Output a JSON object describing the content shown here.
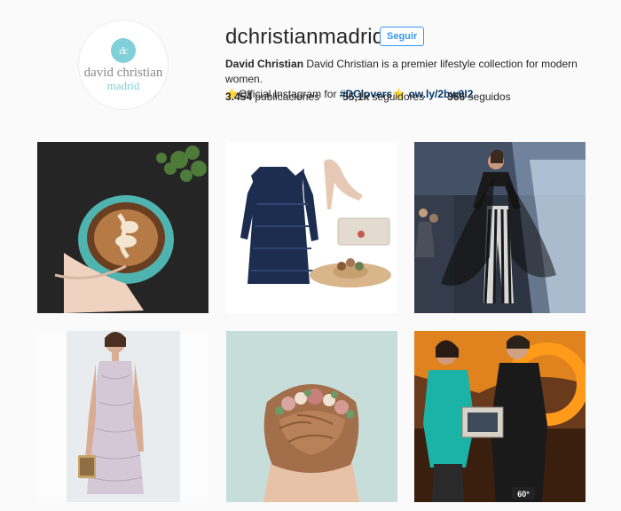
{
  "profile": {
    "avatar": {
      "monogram": "dc",
      "brand_line1": "david christian",
      "brand_line2": "madrid"
    },
    "username": "dchristianmadrid",
    "follow_label": "Seguir",
    "bio": {
      "name": "David Christian",
      "text": "David Christian is a premier lifestyle collection for modern women.",
      "star": "⭐",
      "line2_pre": "Official Instagram for ",
      "hashtag": "#DClovers",
      "link": "ow.ly/2bw0I2"
    },
    "stats": [
      {
        "count": "3.454",
        "label": " publicaciones"
      },
      {
        "count": "55,1k",
        "label": " seguidores"
      },
      {
        "count": "366",
        "label": " seguidos"
      }
    ]
  },
  "posts": [
    {
      "icon": "coffee-latte-art-photo"
    },
    {
      "icon": "navy-dress-flat-lay-photo"
    },
    {
      "icon": "runway-model-photo"
    },
    {
      "icon": "lace-dress-model-photo"
    },
    {
      "icon": "floral-hair-accessory-photo"
    },
    {
      "icon": "tv-show-presenters-photo",
      "badge": "60°"
    }
  ],
  "colors": {
    "accent": "#3897f0",
    "brand_teal": "#7fd0d8",
    "link": "#003569",
    "background": "#fafafa"
  }
}
